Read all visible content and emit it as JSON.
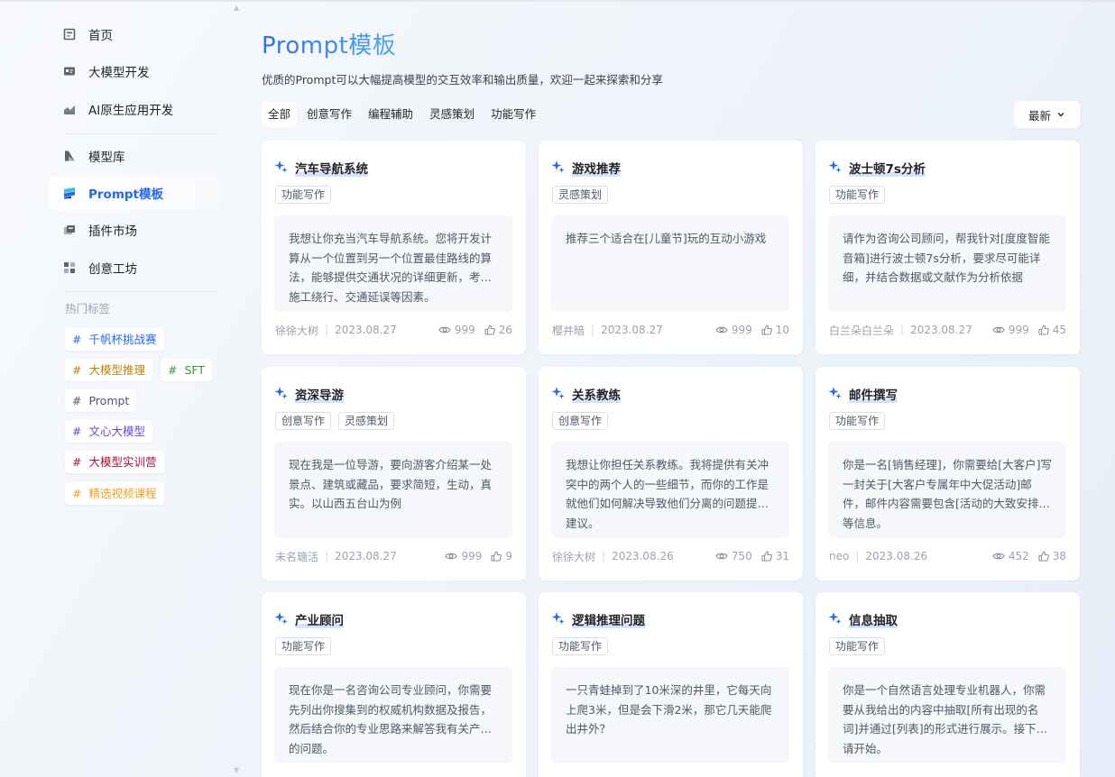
{
  "sidebar": {
    "nav": [
      {
        "label": "首页",
        "icon": "home-icon"
      },
      {
        "label": "大模型开发",
        "icon": "model-dev-icon"
      },
      {
        "label": "AI原生应用开发",
        "icon": "ai-app-icon"
      },
      {
        "label": "模型库",
        "icon": "model-library-icon"
      },
      {
        "label": "Prompt模板",
        "icon": "prompt-template-icon",
        "active": true
      },
      {
        "label": "插件市场",
        "icon": "plugin-market-icon"
      },
      {
        "label": "创意工坊",
        "icon": "creative-workshop-icon"
      }
    ],
    "hot_tags_title": "热门标签",
    "hot_tags": [
      {
        "label": "千帆杯挑战赛",
        "color": "#2468f2"
      },
      {
        "label": "大模型推理",
        "color": "#b8860b"
      },
      {
        "label": "SFT",
        "color": "#2e9a3c"
      },
      {
        "label": "Prompt",
        "color": "#4e5969"
      },
      {
        "label": "文心大模型",
        "color": "#5b4fd8"
      },
      {
        "label": "大模型实训营",
        "color": "#a3123d"
      },
      {
        "label": "精选视频课程",
        "color": "#f0a020"
      }
    ]
  },
  "main": {
    "title": "Prompt模板",
    "subtitle": "优质的Prompt可以大幅提高模型的交互效率和输出质量，欢迎一起来探索和分享",
    "filters": [
      "全部",
      "创意写作",
      "编程辅助",
      "灵感策划",
      "功能写作"
    ],
    "sort_label": "最新",
    "cards": [
      {
        "title": "汽车导航系统",
        "tags": [
          "功能写作"
        ],
        "body": "我想让你充当汽车导航系统。您将开发计算从一个位置到另一个位置最佳路线的算法，能够提供交通状况的详细更新，考虑施工绕行、交通延误等因素。",
        "author": "徐徐大树",
        "date": "2023.08.27",
        "views": "999",
        "likes": "26"
      },
      {
        "title": "游戏推荐",
        "tags": [
          "灵感策划"
        ],
        "body": "推荐三个适合在[儿童节]玩的互动小游戏",
        "author": "樱井暗",
        "date": "2023.08.27",
        "views": "999",
        "likes": "10"
      },
      {
        "title": "波士顿7s分析",
        "tags": [
          "功能写作"
        ],
        "body": "请作为咨询公司顾问，帮我针对[度度智能音箱]进行波士顿7s分析，要求尽可能详细，并结合数据或文献作为分析依据",
        "author": "白兰朵白兰朵",
        "date": "2023.08.27",
        "views": "999",
        "likes": "45"
      },
      {
        "title": "资深导游",
        "tags": [
          "创意写作",
          "灵感策划"
        ],
        "body": "现在我是一位导游，要向游客介绍某一处景点、建筑或藏品，要求简短，生动，真实。以山西五台山为例",
        "author": "未名瑭活",
        "date": "2023.08.27",
        "views": "999",
        "likes": "9"
      },
      {
        "title": "关系教练",
        "tags": [
          "创意写作"
        ],
        "body": "我想让你担任关系教练。我将提供有关冲突中的两个人的一些细节，而你的工作是就他们如何解决导致他们分离的问题提出建议。",
        "author": "徐徐大树",
        "date": "2023.08.26",
        "views": "750",
        "likes": "31"
      },
      {
        "title": "邮件撰写",
        "tags": [
          "功能写作"
        ],
        "body": "你是一名[销售经理]，你需要给[大客户]写一封关于[大客户专属年中大促活动]邮件，邮件内容需要包含[活动的大致安排]等信息。",
        "author": "neo",
        "date": "2023.08.26",
        "views": "452",
        "likes": "38"
      },
      {
        "title": "产业顾问",
        "tags": [
          "功能写作"
        ],
        "body": "现在你是一名咨询公司专业顾问，你需要先列出你搜集到的权威机构数据及报告，然后结合你的专业思路来解答我有关产业的问题。",
        "author": "",
        "date": "",
        "views": "",
        "likes": ""
      },
      {
        "title": "逻辑推理问题",
        "tags": [
          "功能写作"
        ],
        "body": "一只青蛙掉到了10米深的井里，它每天向上爬3米，但是会下滑2米，那它几天能爬出井外？",
        "author": "",
        "date": "",
        "views": "",
        "likes": ""
      },
      {
        "title": "信息抽取",
        "tags": [
          "功能写作"
        ],
        "body": "你是一个自然语言处理专业机器人，你需要从我给出的内容中抽取[所有出现的名词]并通过[列表]的形式进行展示。接下来请开始。",
        "author": "",
        "date": "",
        "views": "",
        "likes": ""
      }
    ]
  }
}
